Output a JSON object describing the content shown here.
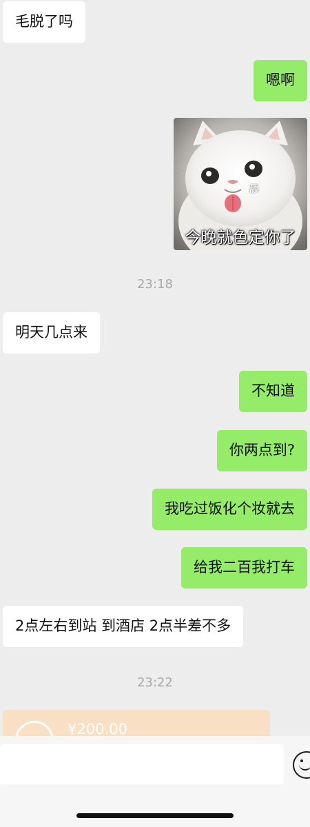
{
  "messages": [
    {
      "side": "incoming",
      "text": "毛脱了吗"
    },
    {
      "side": "outgoing",
      "text": "嗯啊"
    },
    {
      "side": "outgoing",
      "type": "sticker",
      "caption": "今晚就色定你了",
      "small_text": "舔"
    },
    {
      "side": "incoming",
      "text": "明天几点来"
    },
    {
      "side": "outgoing",
      "text": "不知道"
    },
    {
      "side": "outgoing",
      "text": "你两点到?"
    },
    {
      "side": "outgoing",
      "text": "我吃过饭化个妆就去"
    },
    {
      "side": "outgoing",
      "text": "给我二百我打车"
    },
    {
      "side": "incoming",
      "text": "2点左右到站 到酒店 2点半差不多"
    },
    {
      "side": "incoming",
      "type": "transfer",
      "amount": "¥200.00"
    }
  ],
  "timestamps": [
    "23:18",
    "23:22"
  ],
  "input": {
    "value": "",
    "placeholder": ""
  },
  "icons": {
    "emoji": "smiley-face-icon",
    "transfer": "transfer-circle-icon"
  },
  "colors": {
    "background": "#ededed",
    "outgoing_bubble": "#95ec69",
    "incoming_bubble": "#ffffff",
    "transfer_card": "#f9dfc4",
    "timestamp": "#a8a8a8"
  }
}
